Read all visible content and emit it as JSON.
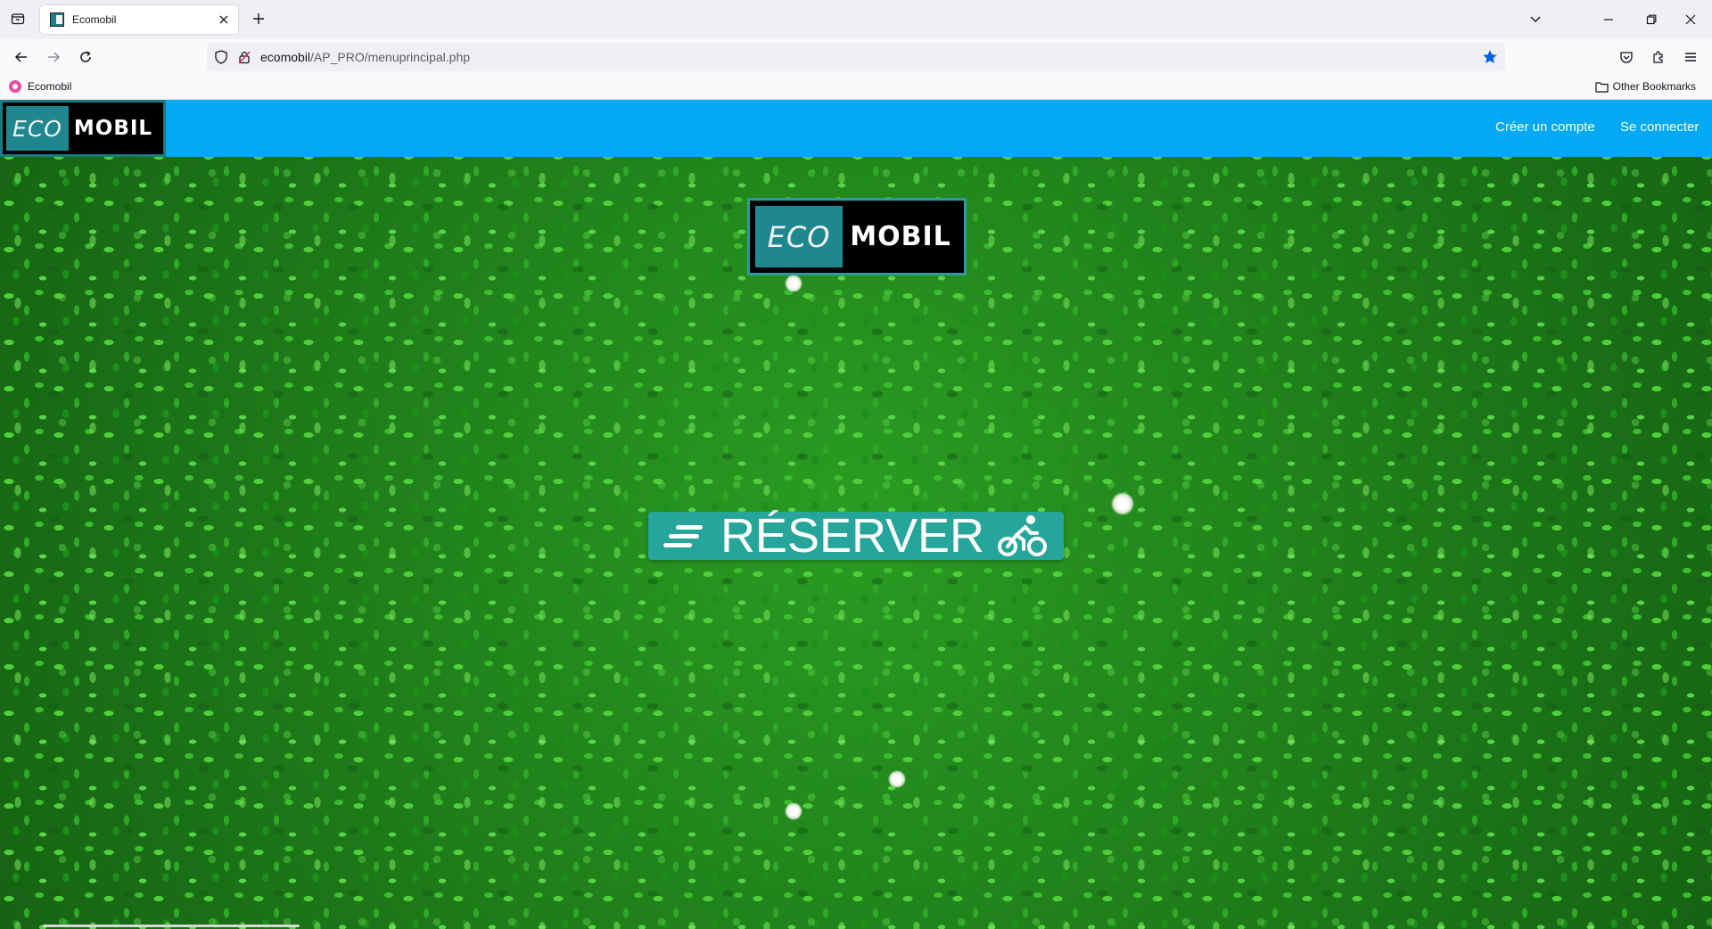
{
  "browser": {
    "tab_title": "Ecomobil",
    "url_host": "ecomobil",
    "url_path": "/AP_PRO/menuprincipal.php",
    "bookmark_label": "Ecomobil",
    "other_bookmarks_label": "Other Bookmarks"
  },
  "site": {
    "logo_eco": "ECO",
    "logo_mobil": "MOBIL",
    "nav": {
      "create_account": "Créer un compte",
      "login": "Se connecter"
    },
    "reserve_label": "RÉSERVER"
  },
  "colors": {
    "header_bg": "#03a9f4",
    "button_bg": "#26a69a",
    "logo_teal": "#1f8790",
    "bookmark_star": "#0061e0"
  },
  "icons": [
    "tab-list-icon",
    "close-icon",
    "plus-icon",
    "chevron-down-icon",
    "minimize-icon",
    "restore-icon",
    "back-icon",
    "forward-icon",
    "reload-icon",
    "shield-icon",
    "lock-icon",
    "star-icon",
    "pocket-icon",
    "extensions-icon",
    "menu-icon",
    "folder-icon",
    "bars-icon",
    "bicycle-icon"
  ]
}
